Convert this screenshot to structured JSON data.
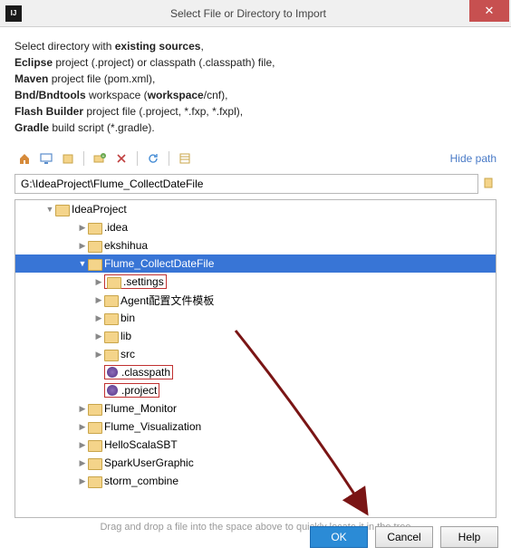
{
  "titlebar": {
    "app_label": "IJ",
    "title": "Select File or Directory to Import"
  },
  "intro": {
    "line1a": "Select directory with ",
    "line1b": "existing sources",
    "line1c": ",",
    "line2a": "Eclipse",
    "line2b": " project (.project) or classpath (.classpath) file,",
    "line3a": "Maven",
    "line3b": " project file (pom.xml),",
    "line4a": "Bnd/Bndtools",
    "line4b": " workspace (",
    "line4c": "workspace",
    "line4d": "/cnf),",
    "line5a": "Flash Builder",
    "line5b": " project file (.project, *.fxp, *.fxpl),",
    "line6a": "Gradle",
    "line6b": " build script (*.gradle)."
  },
  "toolbar": {
    "hide_path": "Hide path"
  },
  "path_input": {
    "value": "G:\\IdeaProject\\Flume_CollectDateFile"
  },
  "tree": {
    "root": "IdeaProject",
    "items": [
      {
        "label": ".idea",
        "depth": 2,
        "arrow": "▶"
      },
      {
        "label": "ekshihua",
        "depth": 2,
        "arrow": "▶"
      },
      {
        "label": "Flume_CollectDateFile",
        "depth": 2,
        "arrow": "▼",
        "selected": true
      },
      {
        "label": ".settings",
        "depth": 3,
        "arrow": "▶",
        "red": true
      },
      {
        "label": "Agent配置文件模板",
        "depth": 3,
        "arrow": "▶"
      },
      {
        "label": "bin",
        "depth": 3,
        "arrow": "▶"
      },
      {
        "label": "lib",
        "depth": 3,
        "arrow": "▶"
      },
      {
        "label": "src",
        "depth": 3,
        "arrow": "▶"
      },
      {
        "label": ".classpath",
        "depth": 3,
        "arrow": "",
        "file": true,
        "red": true
      },
      {
        "label": ".project",
        "depth": 3,
        "arrow": "",
        "file": true,
        "red": true
      },
      {
        "label": "Flume_Monitor",
        "depth": 2,
        "arrow": "▶"
      },
      {
        "label": "Flume_Visualization",
        "depth": 2,
        "arrow": "▶"
      },
      {
        "label": "HelloScalaSBT",
        "depth": 2,
        "arrow": "▶"
      },
      {
        "label": "SparkUserGraphic",
        "depth": 2,
        "arrow": "▶"
      },
      {
        "label": "storm_combine",
        "depth": 2,
        "arrow": "▶"
      }
    ]
  },
  "hint": "Drag and drop a file into the space above to quickly locate it in the tree",
  "buttons": {
    "ok": "OK",
    "cancel": "Cancel",
    "help": "Help"
  }
}
